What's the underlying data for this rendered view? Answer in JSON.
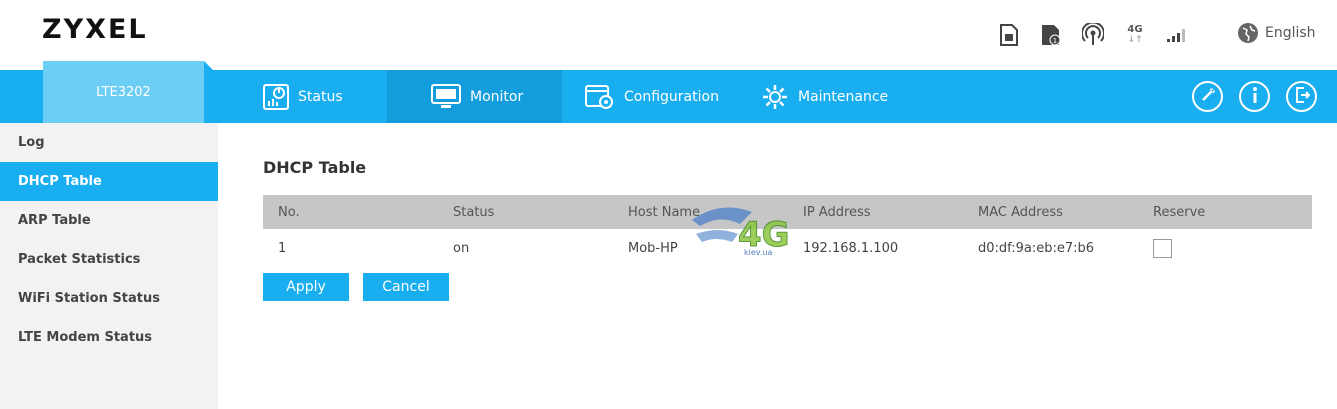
{
  "header": {
    "logo": "ZYXEL",
    "language": "English",
    "network_type": "4G"
  },
  "nav": {
    "model": "LTE3202",
    "items": [
      {
        "label": "Status",
        "icon": "status-icon"
      },
      {
        "label": "Monitor",
        "icon": "monitor-icon"
      },
      {
        "label": "Configuration",
        "icon": "configuration-icon"
      },
      {
        "label": "Maintenance",
        "icon": "gear-icon"
      }
    ],
    "active": "Monitor"
  },
  "sidebar": {
    "items": [
      {
        "label": "Log"
      },
      {
        "label": "DHCP Table"
      },
      {
        "label": "ARP Table"
      },
      {
        "label": "Packet Statistics"
      },
      {
        "label": "WiFi Station Status"
      },
      {
        "label": "LTE Modem Status"
      }
    ],
    "active": "DHCP Table"
  },
  "main": {
    "title": "DHCP Table",
    "columns": [
      "No.",
      "Status",
      "Host Name",
      "IP Address",
      "MAC Address",
      "Reserve"
    ],
    "rows": [
      {
        "no": "1",
        "status": "on",
        "host": "Mob-HP",
        "ip": "192.168.1.100",
        "mac": "d0:df:9a:eb:e7:b6",
        "reserve": false
      }
    ],
    "apply_label": "Apply",
    "cancel_label": "Cancel"
  },
  "watermark": {
    "text": "4G",
    "sub": "kiev.ua"
  },
  "colors": {
    "accent": "#19aef0",
    "model_tab": "#6ccdf5",
    "active_nav": "#139ddd",
    "table_header": "#c6c6c6",
    "sidebar_bg": "#f2f2f2"
  }
}
